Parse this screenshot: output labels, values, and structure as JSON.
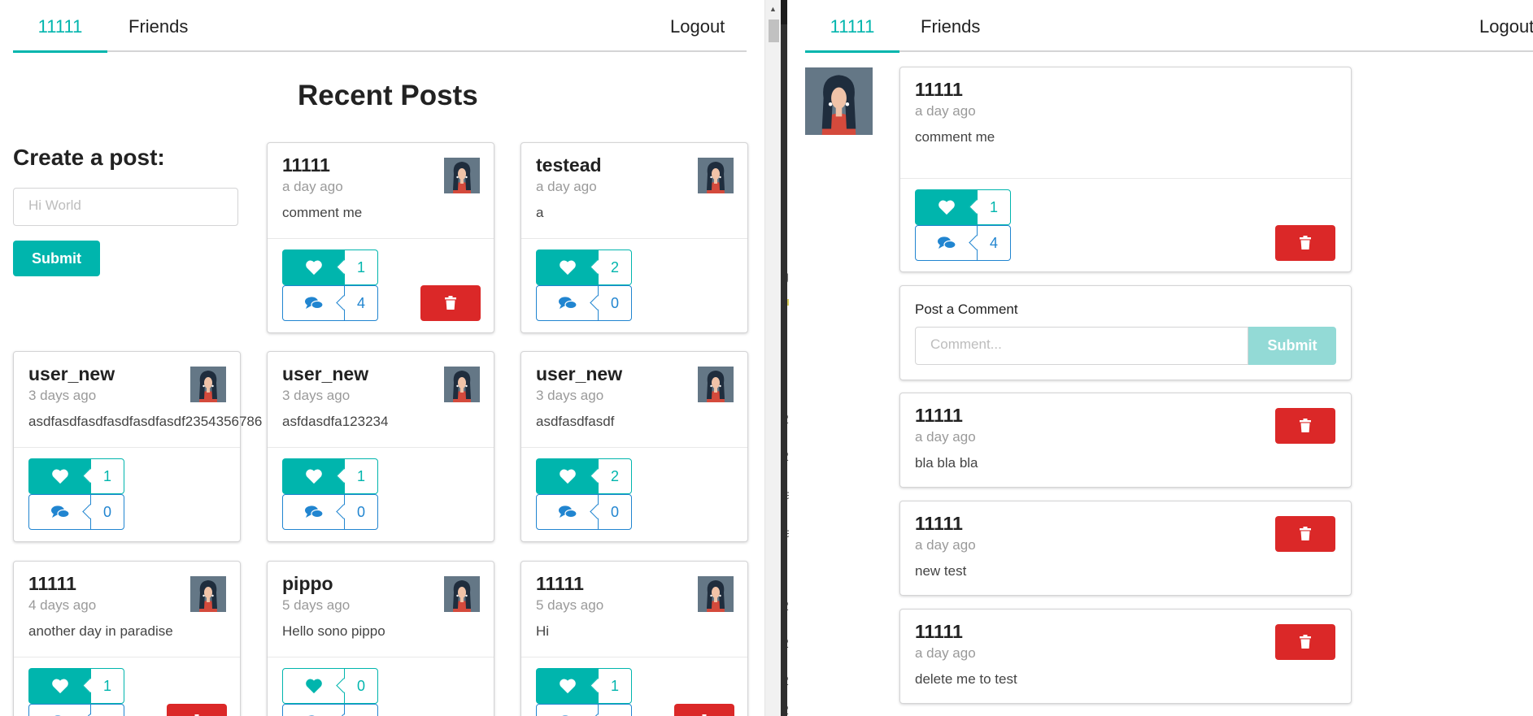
{
  "left": {
    "menu": {
      "home": "11111",
      "friends": "Friends",
      "logout": "Logout"
    },
    "page_title": "Recent Posts",
    "create": {
      "heading": "Create a post:",
      "placeholder": "Hi World",
      "submit": "Submit"
    },
    "posts": [
      {
        "name": "11111",
        "time": "a day ago",
        "content": "comment me",
        "likes": "1",
        "comments": "4",
        "liked": true,
        "deletable": true
      },
      {
        "name": "testead",
        "time": "a day ago",
        "content": "a",
        "likes": "2",
        "comments": "0",
        "liked": true,
        "deletable": false
      },
      {
        "name": "user_new",
        "time": "3 days ago",
        "content": "asdfasdfasdfasdfasdfasdf2354356786",
        "likes": "1",
        "comments": "0",
        "liked": true,
        "deletable": false
      },
      {
        "name": "user_new",
        "time": "3 days ago",
        "content": "asfdasdfa123234",
        "likes": "1",
        "comments": "0",
        "liked": true,
        "deletable": false
      },
      {
        "name": "user_new",
        "time": "3 days ago",
        "content": "asdfasdfasdf",
        "likes": "2",
        "comments": "0",
        "liked": true,
        "deletable": false
      },
      {
        "name": "11111",
        "time": "4 days ago",
        "content": "another day in paradise",
        "likes": "1",
        "comments": "",
        "liked": true,
        "deletable": true
      },
      {
        "name": "pippo",
        "time": "5 days ago",
        "content": "Hello sono pippo",
        "likes": "0",
        "comments": "",
        "liked": false,
        "deletable": false
      },
      {
        "name": "11111",
        "time": "5 days ago",
        "content": "Hi",
        "likes": "1",
        "comments": "",
        "liked": true,
        "deletable": true
      }
    ]
  },
  "right": {
    "menu": {
      "home": "11111",
      "friends": "Friends",
      "logout": "Logout"
    },
    "post": {
      "name": "11111",
      "time": "a day ago",
      "content": "comment me",
      "likes": "1",
      "comments": "4"
    },
    "comment_form": {
      "label": "Post a Comment",
      "placeholder": "Comment...",
      "submit": "Submit"
    },
    "comments": [
      {
        "name": "11111",
        "time": "a day ago",
        "content": "bla bla bla"
      },
      {
        "name": "11111",
        "time": "a day ago",
        "content": "new test"
      },
      {
        "name": "11111",
        "time": "a day ago",
        "content": "delete me to test"
      }
    ]
  },
  "background_fragments": [
    "g",
    "2",
    "2",
    "ia",
    "ia",
    "2",
    "2",
    "2",
    "2"
  ],
  "colors": {
    "teal": "#00b5ad",
    "blue": "#2185d0",
    "red": "#db2828",
    "border": "#d4d4d5"
  },
  "icons": {
    "like": "heart-icon",
    "comment": "comments-icon",
    "delete": "trash-icon",
    "avatar": "user-avatar-image"
  }
}
